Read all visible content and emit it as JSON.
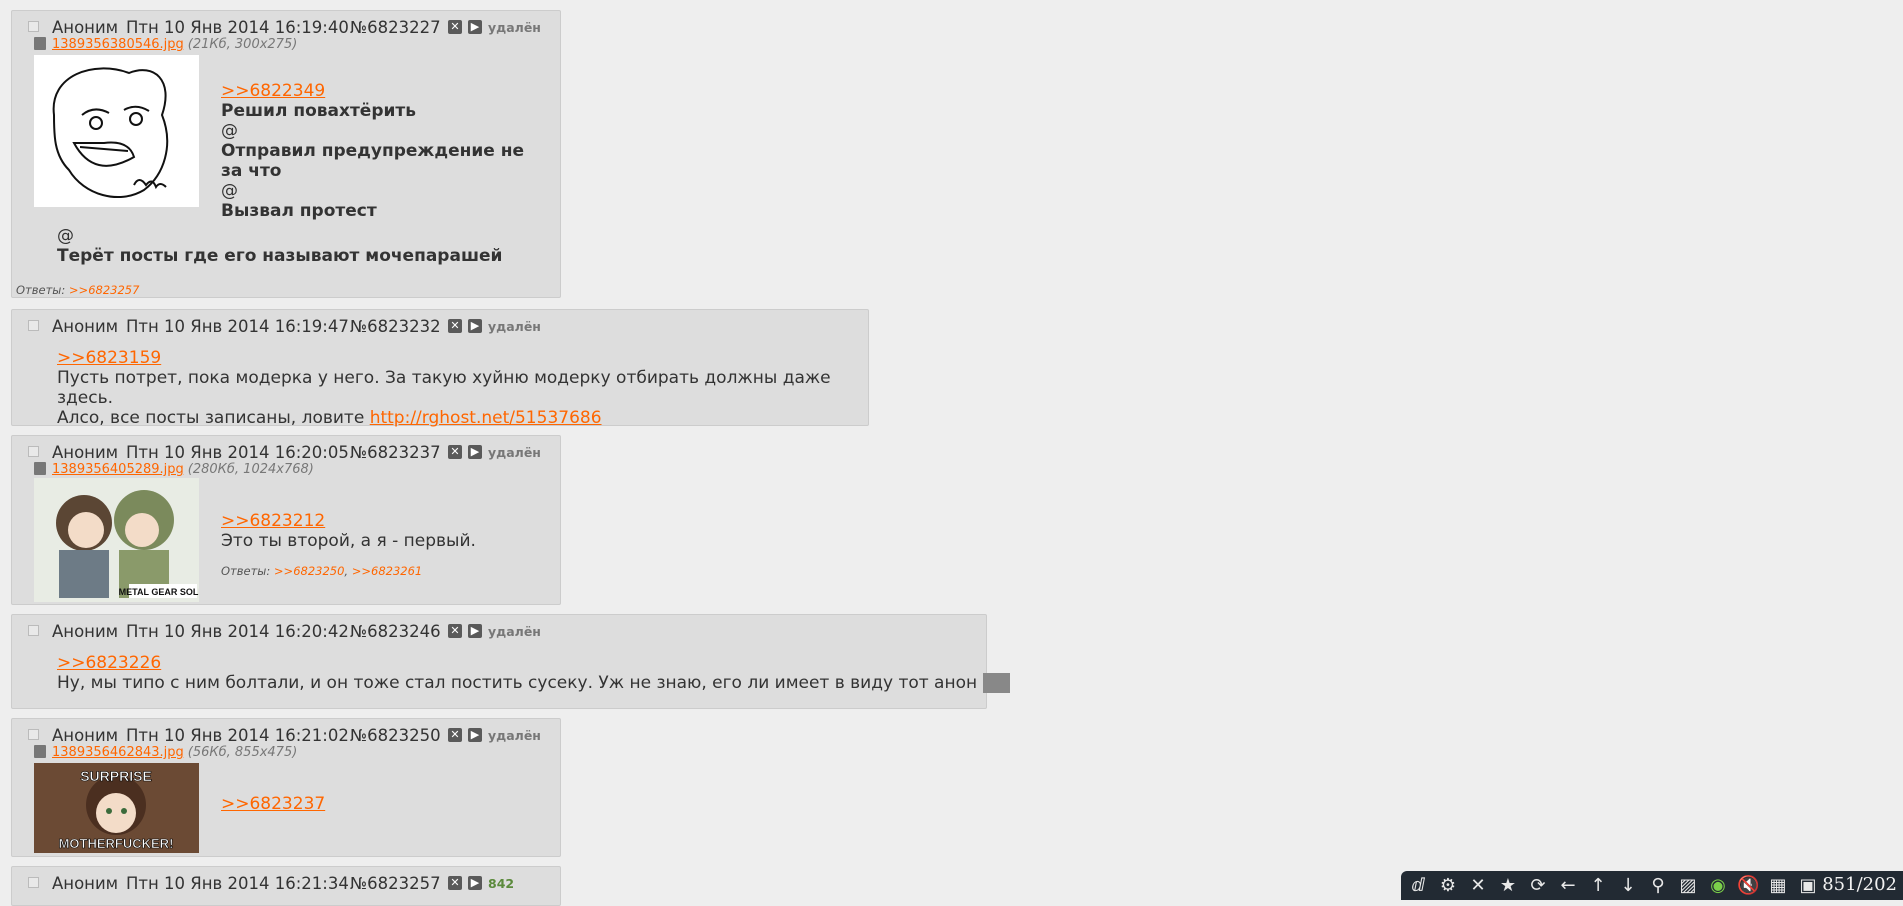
{
  "posts": [
    {
      "name": "Аноним",
      "date": "Птн 10 Янв 2014 16:19:40",
      "num": "№6823227",
      "status": "удалён",
      "file": {
        "link": "1389356380546.jpg",
        "meta": "(21Кб, 300x275)"
      },
      "ref": ">>6822349",
      "lines": [
        "Решил повахтёрить",
        "@",
        "Отправил предупреждение не",
        "за что",
        "@",
        "Вызвал протест"
      ],
      "lines_wide": [
        "@",
        "Терёт посты где его называют мочепарашей"
      ],
      "replies_label": "Ответы:",
      "replies": [
        ">>6823257"
      ]
    },
    {
      "name": "Аноним",
      "date": "Птн 10 Янв 2014 16:19:47",
      "num": "№6823232",
      "status": "удалён",
      "ref": ">>6823159",
      "line1": "Пусть потрет, пока модерка у него. За такую хуйню модерку отбирать должны даже здесь.",
      "line2_prefix": "Алсо, все посты записаны, ловите ",
      "line2_link": "http://rghost.net/51537686"
    },
    {
      "name": "Аноним",
      "date": "Птн 10 Янв 2014 16:20:05",
      "num": "№6823237",
      "status": "удалён",
      "file": {
        "link": "1389356405289.jpg",
        "meta": "(280Кб, 1024x768)"
      },
      "thumb_caption": "METAL GEAR SOLID",
      "ref": ">>6823212",
      "line1": "Это ты второй, а я - первый.",
      "replies_label": "Ответы:",
      "replies": [
        ">>6823250",
        ">>6823261"
      ]
    },
    {
      "name": "Аноним",
      "date": "Птн 10 Янв 2014 16:20:42",
      "num": "№6823246",
      "status": "удалён",
      "ref": ">>6823226",
      "line1": "Ну, мы типо с ним болтали, и он тоже стал постить сусеку. Уж не знаю, его ли имеет в виду тот анон",
      "spoiler": "_-_"
    },
    {
      "name": "Аноним",
      "date": "Птн 10 Янв 2014 16:21:02",
      "num": "№6823250",
      "status": "удалён",
      "file": {
        "link": "1389356462843.jpg",
        "meta": "(56Кб, 855x475)"
      },
      "thumb_top": "SURPRISE",
      "thumb_bottom": "MOTHERFUCKER!",
      "ref": ">>6823237"
    },
    {
      "name": "Аноним",
      "date": "Птн 10 Янв 2014 16:21:34",
      "num": "№6823257",
      "status": "842"
    }
  ],
  "toolbar": {
    "icons": [
      "logo-icon",
      "gear-icon",
      "close-icon",
      "star-icon",
      "refresh-icon",
      "arrow-left-icon",
      "arrow-up-icon",
      "arrow-down-icon",
      "zoom-icon",
      "hatch-icon",
      "eye-icon",
      "mute-icon",
      "grid-icon",
      "save-icon"
    ],
    "counter": "851/202"
  }
}
